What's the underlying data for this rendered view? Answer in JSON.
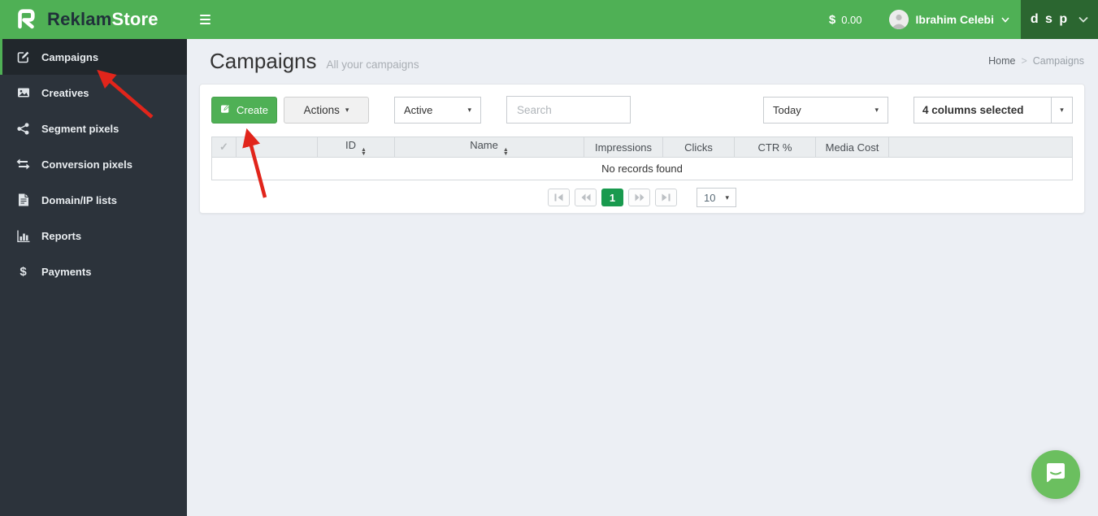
{
  "header": {
    "brand_part1": "Reklam",
    "brand_part2": "Store",
    "balance_currency": "$",
    "balance_amount": "0.00",
    "user_name": "Ibrahim Celebi",
    "workspace_label": "d s p"
  },
  "sidebar": {
    "items": [
      {
        "label": "Campaigns",
        "icon": "edit-square-icon",
        "active": true
      },
      {
        "label": "Creatives",
        "icon": "image-icon",
        "active": false
      },
      {
        "label": "Segment pixels",
        "icon": "share-icon",
        "active": false
      },
      {
        "label": "Conversion pixels",
        "icon": "exchange-icon",
        "active": false
      },
      {
        "label": "Domain/IP lists",
        "icon": "document-icon",
        "active": false
      },
      {
        "label": "Reports",
        "icon": "bar-chart-icon",
        "active": false
      },
      {
        "label": "Payments",
        "icon": "dollar-icon",
        "active": false
      }
    ]
  },
  "page": {
    "title": "Campaigns",
    "subtitle": "All your campaigns",
    "breadcrumb": {
      "home": "Home",
      "separator": ">",
      "current": "Campaigns"
    }
  },
  "toolbar": {
    "create_label": "Create",
    "actions_label": "Actions",
    "status_filter_value": "Active",
    "search_placeholder": "Search",
    "date_filter_value": "Today",
    "columns_selector_value": "4 columns selected"
  },
  "table": {
    "columns": [
      "",
      "",
      "ID",
      "Name",
      "Impressions",
      "Clicks",
      "CTR %",
      "Media Cost",
      ""
    ],
    "sortable_columns": [
      "ID",
      "Name"
    ],
    "empty_message": "No records found"
  },
  "pagination": {
    "current_page": "1",
    "page_size": "10"
  },
  "colors": {
    "header_green": "#4fb055",
    "workspace_dark_green": "#2b6630",
    "sidebar_dark": "#2c333b",
    "active_page_green": "#199a4e",
    "chat_green": "#6bbf5f",
    "annotation_red": "#e1251b"
  }
}
